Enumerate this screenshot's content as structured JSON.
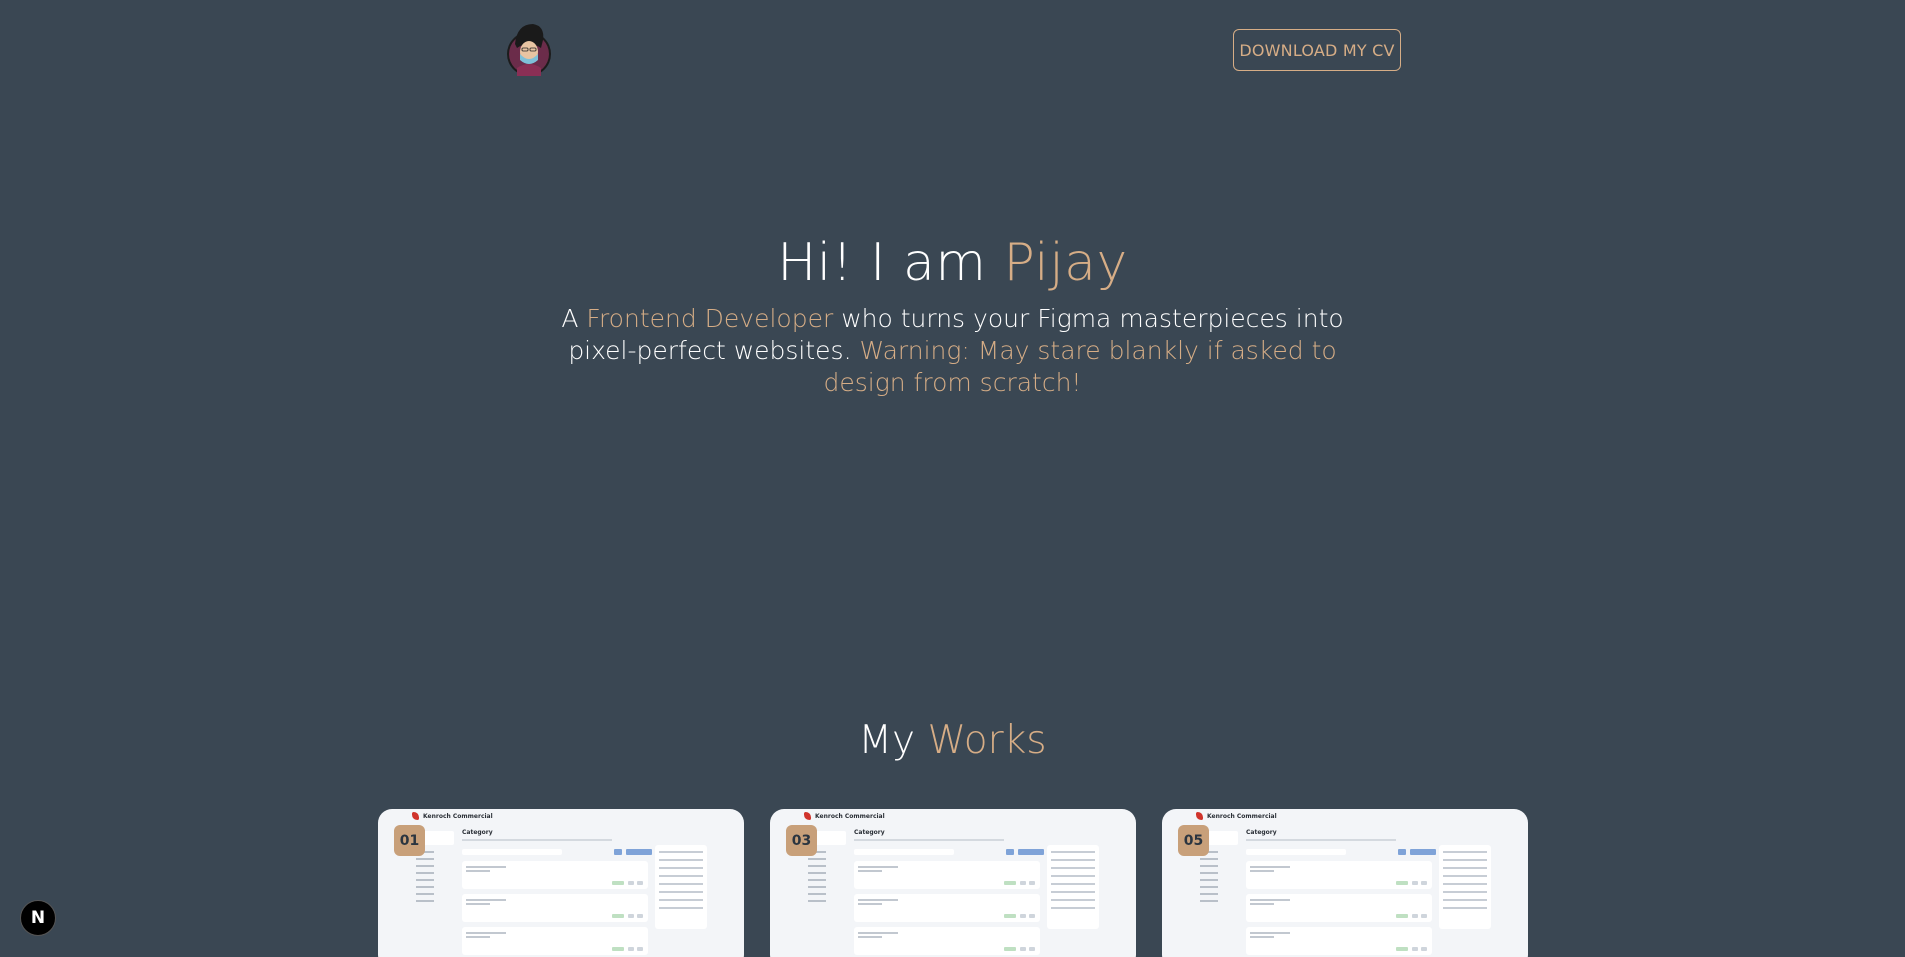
{
  "header": {
    "cv_button": "DOWNLOAD MY CV"
  },
  "hero": {
    "greeting": "Hi! I am ",
    "name": "Pijay",
    "sub_part1": "A ",
    "sub_role": "Frontend Developer",
    "sub_part2": " who turns your Figma masterpieces into pixel-perfect websites. ",
    "sub_warning": "Warning: May stare blankly if asked to design from scratch!"
  },
  "works": {
    "title_white": "My ",
    "title_accent": "Works",
    "cards": [
      {
        "number": "01",
        "brand": "Kenroch Commercial",
        "page_title": "Category"
      },
      {
        "number": "03",
        "brand": "Kenroch Commercial",
        "page_title": "Category"
      },
      {
        "number": "05",
        "brand": "Kenroch Commercial",
        "page_title": "Category"
      }
    ]
  },
  "badge": {
    "letter": "N"
  },
  "colors": {
    "background": "#3a4753",
    "accent": "#d6ad86"
  }
}
